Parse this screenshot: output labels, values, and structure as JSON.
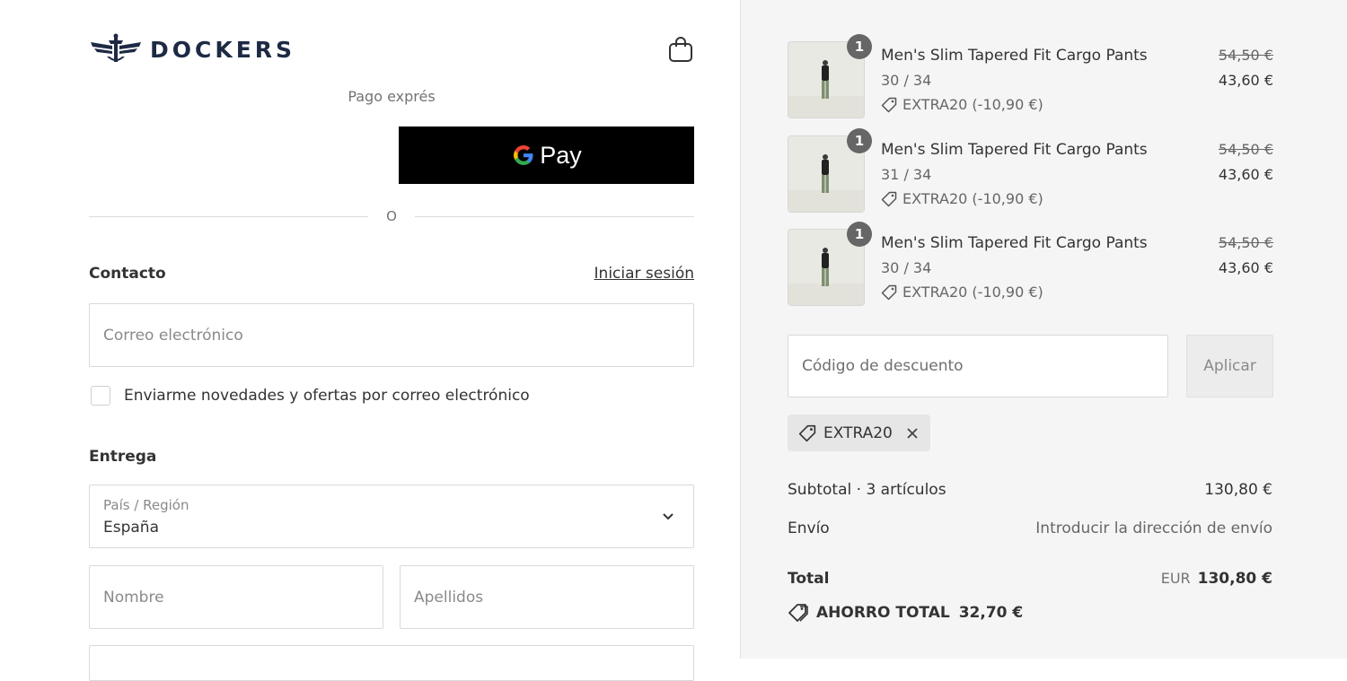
{
  "brand": {
    "name": "DOCKERS"
  },
  "express": {
    "label": "Pago exprés",
    "gpay_label": "Pay"
  },
  "separator": {
    "label": "O"
  },
  "contact": {
    "title": "Contacto",
    "login_link": "Iniciar sesión",
    "email_placeholder": "Correo electrónico",
    "newsletter_label": "Enviarme novedades y ofertas por correo electrónico"
  },
  "delivery": {
    "title": "Entrega",
    "country_label": "País / Región",
    "country_value": "España",
    "first_name_placeholder": "Nombre",
    "last_name_placeholder": "Apellidos"
  },
  "cart": {
    "items": [
      {
        "name": "Men's Slim Tapered Fit Cargo Pants",
        "variant": "30 / 34",
        "discount": "EXTRA20 (-10,90 €)",
        "price_old": "54,50 €",
        "price_new": "43,60 €",
        "qty": "1"
      },
      {
        "name": "Men's Slim Tapered Fit Cargo Pants",
        "variant": "31 / 34",
        "discount": "EXTRA20 (-10,90 €)",
        "price_old": "54,50 €",
        "price_new": "43,60 €",
        "qty": "1"
      },
      {
        "name": "Men's Slim Tapered Fit Cargo Pants",
        "variant": "30 / 34",
        "discount": "EXTRA20 (-10,90 €)",
        "price_old": "54,50 €",
        "price_new": "43,60 €",
        "qty": "1"
      }
    ]
  },
  "discount": {
    "placeholder": "Código de descuento",
    "apply_label": "Aplicar",
    "applied_code": "EXTRA20"
  },
  "summary": {
    "subtotal_label": "Subtotal · 3 artículos",
    "subtotal_value": "130,80 €",
    "shipping_label": "Envío",
    "shipping_value": "Introducir la dirección de envío",
    "total_label": "Total",
    "total_currency": "EUR",
    "total_value": "130,80 €",
    "savings_label": "AHORRO TOTAL",
    "savings_value": "32,70 €"
  },
  "colors": {
    "brand_navy": "#1e2a44",
    "gpay_bg": "#000000",
    "sidebar_bg": "#f5f5f5",
    "badge": "#666666"
  },
  "icons": [
    "logo-emblem-icon",
    "shopping-bag-icon",
    "google-g-icon",
    "tag-icon",
    "close-icon",
    "chevron-down-icon",
    "savings-tag-icon"
  ]
}
